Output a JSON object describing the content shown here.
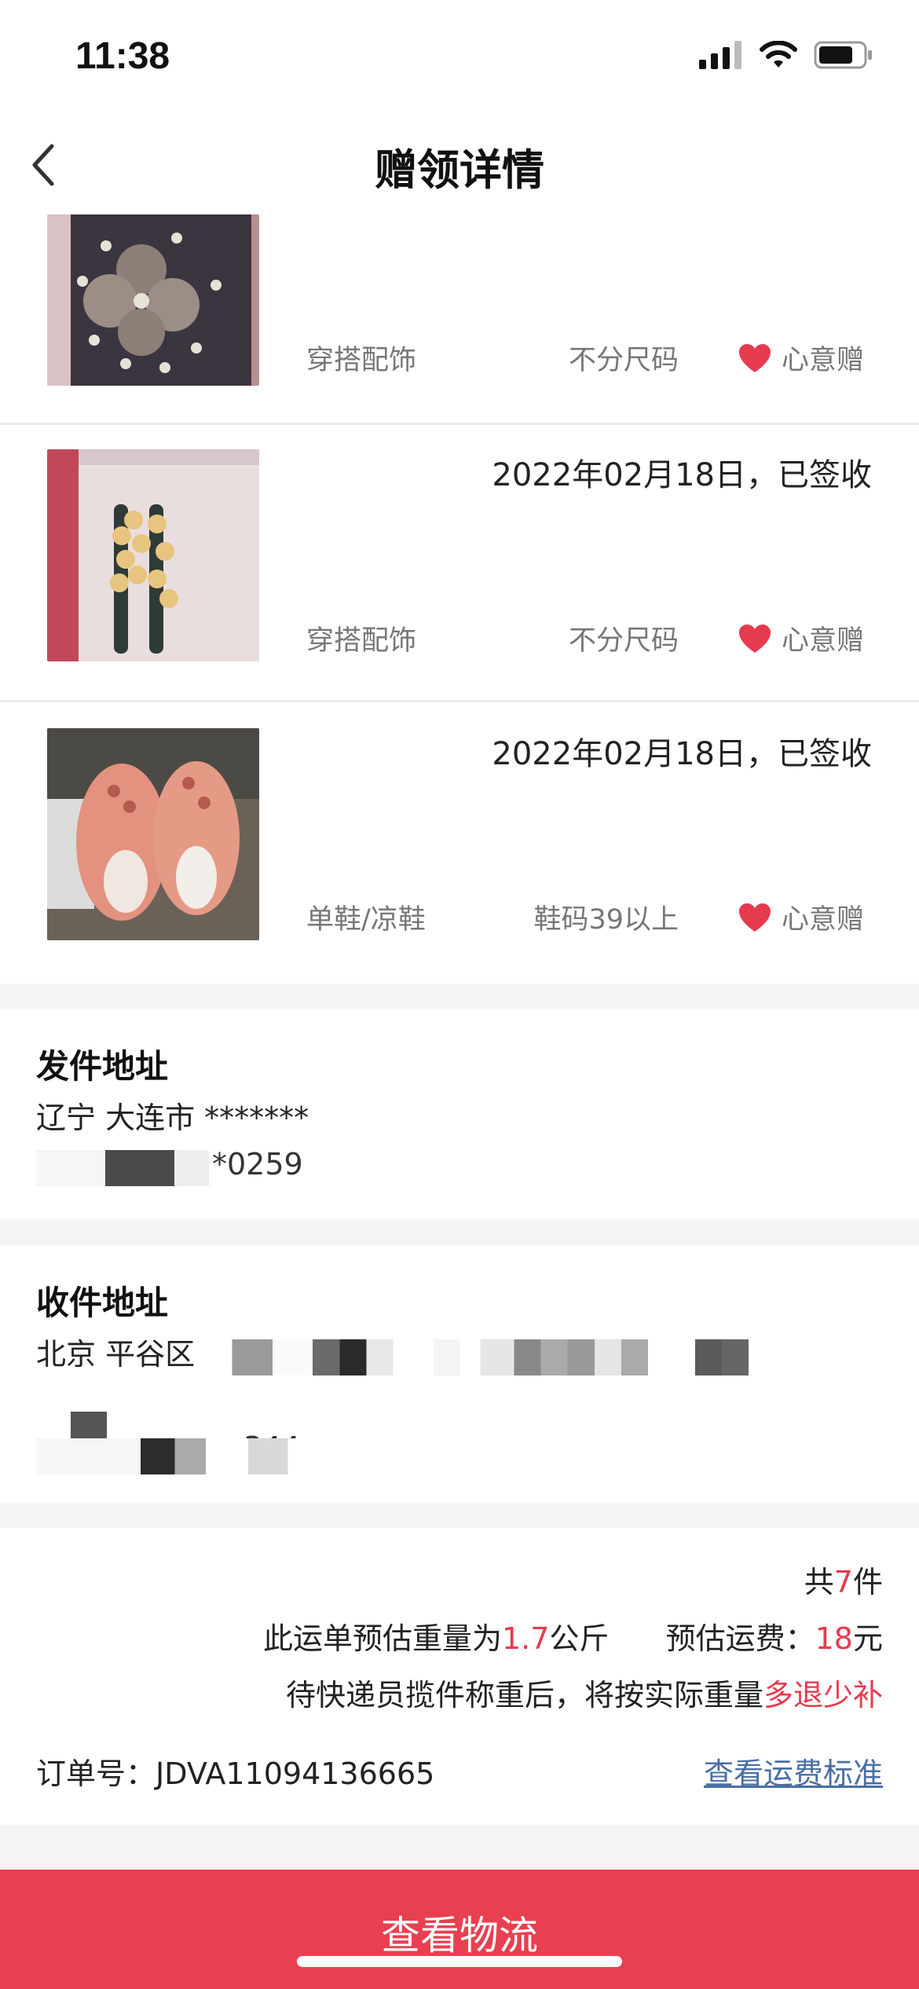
{
  "status_bar": {
    "time": "11:38"
  },
  "nav": {
    "title": "赠领详情"
  },
  "items": [
    {
      "date": "",
      "category": "穿搭配饰",
      "size": "不分尺码",
      "gift_label": "心意赠"
    },
    {
      "date": "2022年02月18日，已签收",
      "category": "穿搭配饰",
      "size": "不分尺码",
      "gift_label": "心意赠"
    },
    {
      "date": "2022年02月18日，已签收",
      "category": "单鞋/凉鞋",
      "size": "鞋码39以上",
      "gift_label": "心意赠"
    }
  ],
  "sender": {
    "title": "发件地址",
    "line1": "辽宁 大连市 *******",
    "line2_fragment": "*0259"
  },
  "receiver": {
    "title": "收件地址",
    "line1_fragment": "北京 平谷区",
    "line3_fragment": "344"
  },
  "summary": {
    "count_prefix": "共",
    "count": "7",
    "count_suffix": "件",
    "weight_prefix": "此运单预估重量为",
    "weight": "1.7",
    "weight_unit": "公斤",
    "fee_prefix": "预估运费：",
    "fee": "18",
    "fee_unit": "元",
    "note_prefix": "待快递员揽件称重后，将按实际重量",
    "note_highlight": "多退少补",
    "order_label": "订单号：",
    "order_no": "JDVA11094136665",
    "fee_link": "查看运费标准"
  },
  "bottom_button": {
    "label": "查看物流"
  },
  "colors": {
    "accent": "#e84050",
    "highlight": "#e63a4f",
    "link": "#4a6fa5"
  }
}
